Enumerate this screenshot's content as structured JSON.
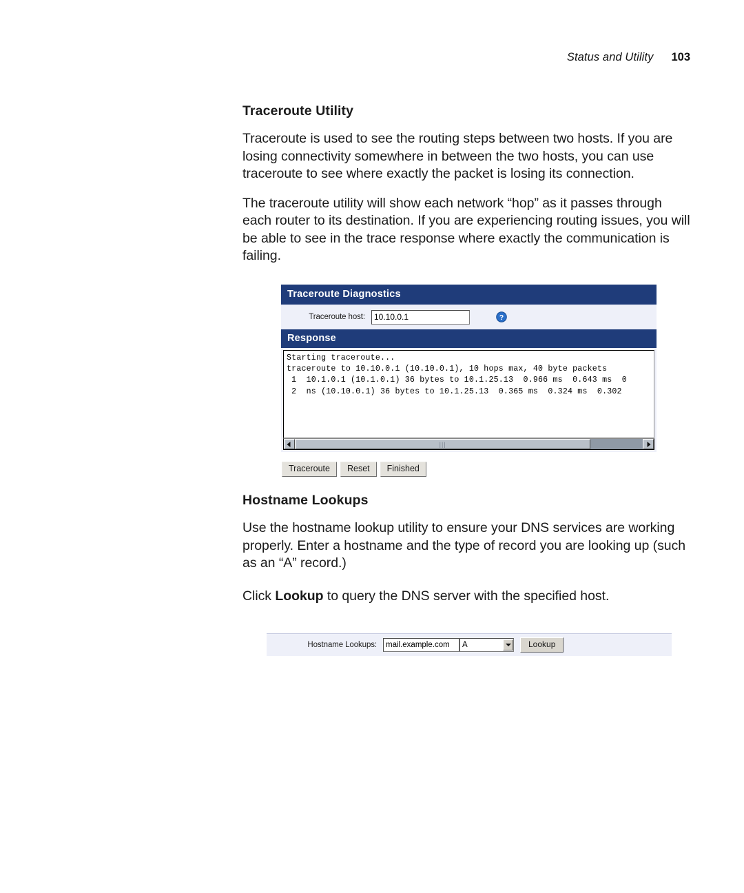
{
  "header": {
    "title": "Status and Utility",
    "page_number": "103"
  },
  "sections": [
    {
      "title": "Traceroute Utility",
      "paragraphs": [
        "Traceroute is used to see the routing steps between two hosts. If you are losing connectivity somewhere in between the two hosts, you can use traceroute to see where exactly the packet is losing its connection.",
        "The traceroute utility will show each network “hop” as it passes through each router to its destination. If you are experiencing routing issues, you will be able to see in the trace response where exactly the communication is failing."
      ]
    },
    {
      "title": "Hostname Lookups",
      "paragraphs": [
        "Use the hostname lookup utility to ensure your DNS services are working properly. Enter a hostname and the type of record you are looking up (such as an “A” record.)"
      ],
      "closing": {
        "before": "Click ",
        "bold": "Lookup",
        "after": " to query the DNS server with the specified host."
      }
    }
  ],
  "traceroute_widget": {
    "title": "Traceroute Diagnostics",
    "host_label": "Traceroute host:",
    "host_value": "10.10.0.1",
    "host_placeholder": "",
    "help_icon": "help-circle-icon",
    "response_title": "Response",
    "response_text": "Starting traceroute...\ntraceroute to 10.10.0.1 (10.10.0.1), 10 hops max, 40 byte packets\n 1  10.1.0.1 (10.1.0.1) 36 bytes to 10.1.25.13  0.966 ms  0.643 ms  0\n 2  ns (10.10.0.1) 36 bytes to 10.1.25.13  0.365 ms  0.324 ms  0.302",
    "scrollbar": {
      "left_arrow_icon": "triangle-left-icon",
      "right_arrow_icon": "triangle-right-icon",
      "grip": "|||",
      "thumb_width_percent": "85"
    },
    "buttons": [
      {
        "label": "Traceroute",
        "name": "traceroute-button"
      },
      {
        "label": "Reset",
        "name": "reset-button"
      },
      {
        "label": "Finished",
        "name": "finished-button"
      }
    ]
  },
  "hostname_widget": {
    "label": "Hostname Lookups:",
    "host_value": "mail.example.com",
    "host_placeholder": "",
    "record_type": "A",
    "record_options": [
      "A"
    ],
    "dropdown_icon": "chevron-down-icon",
    "button_label": "Lookup"
  },
  "colors": {
    "header_bar": "#1f3c7a",
    "field_panel": "#eef0f9",
    "help_icon": "#2a6fc9",
    "scrollbar_track": "#8f99a6",
    "scrollbar_thumb": "#b9c0c9"
  }
}
